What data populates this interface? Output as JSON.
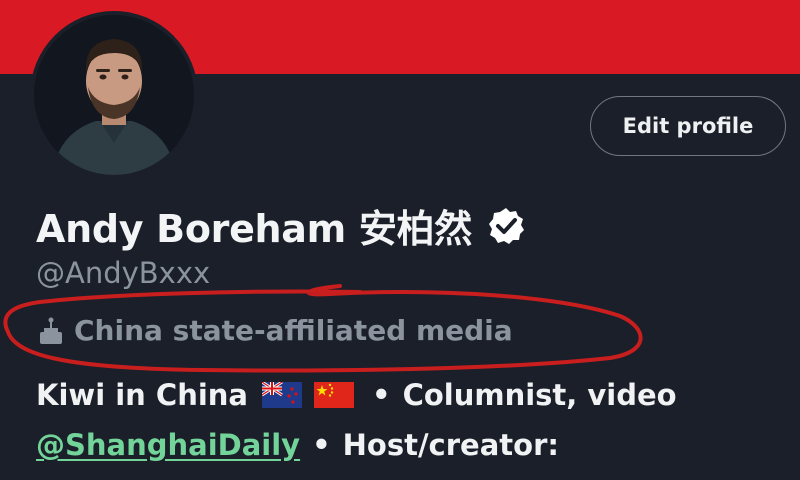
{
  "profile": {
    "display_name": "Andy Boreham 安柏然",
    "handle": "@AndyBxxx",
    "edit_button_label": "Edit profile",
    "affiliation_label": "China state-affiliated media",
    "affiliation_icon": "podium-icon",
    "verified_icon": "verified-badge-icon"
  },
  "bio": {
    "line1_prefix": "Kiwi in China",
    "flags": [
      "new-zealand-flag",
      "china-flag"
    ],
    "bullet": "•",
    "line1_suffix": "Columnist, video",
    "mention": "@ShanghaiDaily",
    "line2_suffix": "Host/creator:"
  },
  "colors": {
    "banner": "#d91a25",
    "background": "#1b1f29",
    "annotation_circle": "#c81e1e",
    "mention": "#73d49a",
    "muted_text": "#8b949e"
  }
}
